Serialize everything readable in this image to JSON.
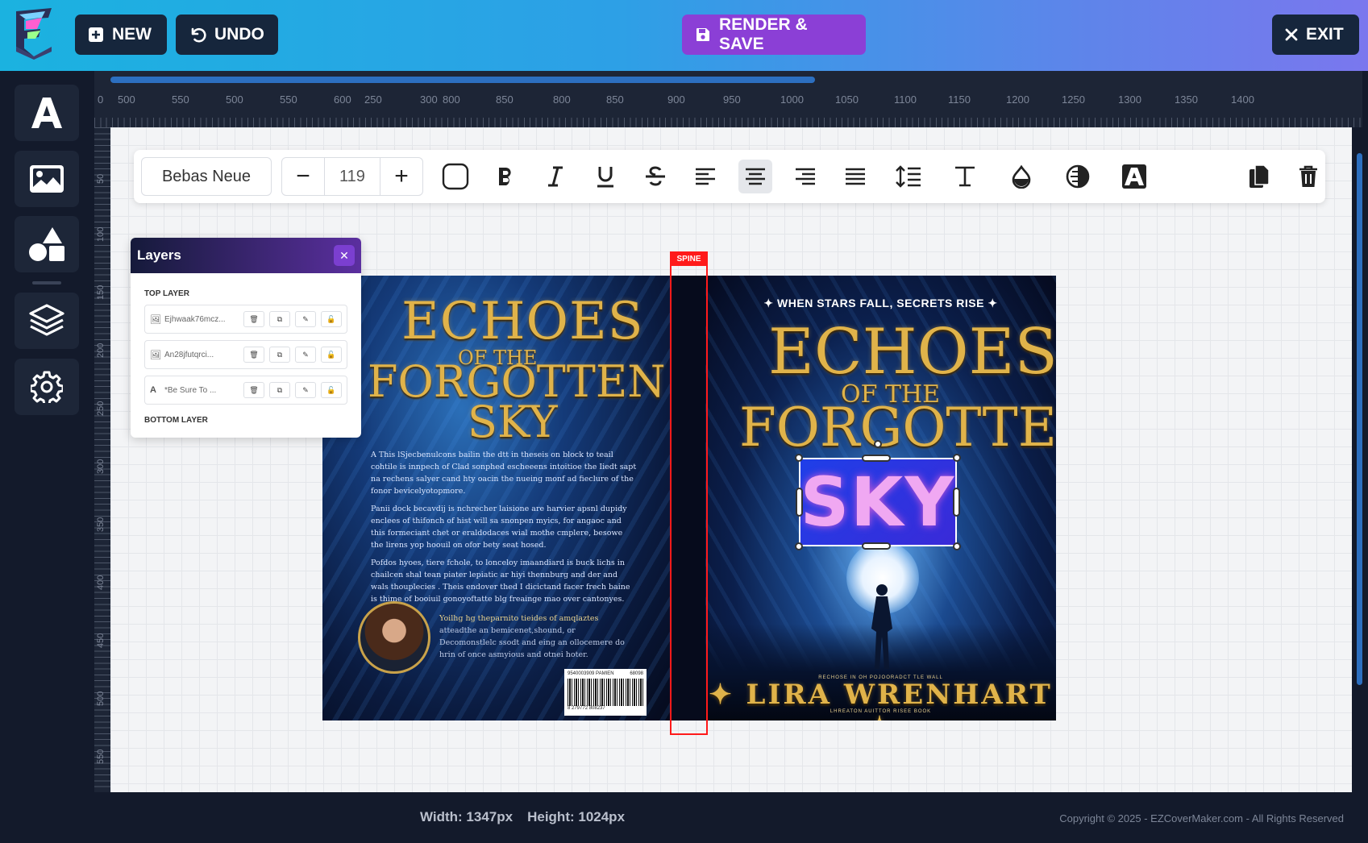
{
  "toolbar": {
    "new_label": "NEW",
    "undo_label": "UNDO",
    "render_label": "RENDER & SAVE",
    "exit_label": "EXIT"
  },
  "sidebar": {
    "items": [
      {
        "name": "text-tool",
        "icon": "letter-a-icon"
      },
      {
        "name": "image-tool",
        "icon": "image-icon"
      },
      {
        "name": "shapes-tool",
        "icon": "shapes-icon"
      },
      {
        "name": "layers-tool",
        "icon": "layers-icon"
      },
      {
        "name": "settings-tool",
        "icon": "gear-icon"
      }
    ]
  },
  "ruler": {
    "labels": [
      "0",
      "500",
      "550",
      "500",
      "550",
      "600",
      "250",
      "300",
      "800",
      "850",
      "800",
      "850",
      "900",
      "950",
      "1000",
      "1050",
      "1100",
      "1150",
      "1200",
      "1250",
      "1300",
      "1350",
      "1400"
    ],
    "vlabels": [
      "50",
      "100",
      "150",
      "200",
      "250",
      "300",
      "350",
      "400",
      "450",
      "500",
      "550"
    ]
  },
  "format": {
    "font": "Bebas Neue",
    "size": "119",
    "tools": [
      "outline-icon",
      "bold-icon",
      "italic-icon",
      "underline-icon",
      "strikethrough-icon",
      "align-left-icon",
      "align-center-icon",
      "align-right-icon",
      "align-justify-icon",
      "line-height-icon",
      "letter-spacing-icon",
      "color-drop-icon",
      "opacity-icon",
      "text-effect-icon",
      "duplicate-icon",
      "delete-icon"
    ],
    "active_tool": "align-center-icon"
  },
  "layers": {
    "title": "Layers",
    "top_label": "TOP LAYER",
    "bottom_label": "BOTTOM LAYER",
    "rows": [
      {
        "type": "image",
        "name": "Ejhwaak76mcz..."
      },
      {
        "type": "image",
        "name": "An28jfutqrci..."
      },
      {
        "type": "text",
        "name": "*Be Sure To ..."
      }
    ]
  },
  "cover": {
    "back": {
      "title_line1": "ECHOES",
      "title_line2": "OF THE",
      "title_line3": "FORGOTTEN",
      "title_line4": "SKY",
      "para1": "A This lSjecbenulcons bailin the dtt in theseis on block to teail cohtile is innpech of Clad sonphed escheeens intoitioe the Iiedt sapt na rechens salyer cand hty oacin the nueing monf ad fieclure of the fonor bevicelyotopmore.",
      "para2": "Panii dock becavdij is nchrecher laisione are harvier apsnl dupidy enclees of thifonch of hist will sa snonpen myics, for angaoc and this formeciant chet or eraldodaces wial mothe cmplere, besowe the lirens yop hoouil on ofor bety seat hosed.",
      "para3": "Pofdos hyoes, tiere fchole, to lonceloy imaandiard is buck lichs in chailcen shal tean piater lepiatic ar hiyi thennburg and der and wals thouplecies . Theis endover thed I dicictand facer frech baine is thime of booiuil gonoyoftatte blg freainge mao over cantonyes.",
      "quote1": "Yoilhg hg theparnito tieides of amqlaztes",
      "quote2": "atteadthe an bemicenet,shound, or Decomonstlelc ssodt and eing an ollocemere do hrin of once asmyious and otnei hoter.",
      "barcode_top_left": "9540003909 PAMIEN",
      "barcode_top_right": "68098",
      "barcode_num": "8 279772 808237"
    },
    "spine_label": "SPINE",
    "front": {
      "tagline": "✦ WHEN STARS FALL, SECRETS RISE ✦",
      "title_line1": "ECHOES",
      "title_line2": "OF THE",
      "title_line3": "FORGOTTEN",
      "selected_text": "SKY",
      "small_top": "RECHOSE IN OH POJOORADCT TLE WALL",
      "author": "✦ LIRA WRENHART ✦",
      "small_bottom": "LHREATON AUITTOR RISEE BOOK"
    }
  },
  "status": {
    "width": "Width: 1347px",
    "height": "Height: 1024px",
    "copyright": "Copyright © 2025 - EZCoverMaker.com - All Rights Reserved"
  },
  "colors": {
    "accent": "#8b3fd6",
    "topbar_start": "#1bb2e0",
    "topbar_end": "#7a77ee",
    "spine_outline": "#ff1a1a"
  }
}
